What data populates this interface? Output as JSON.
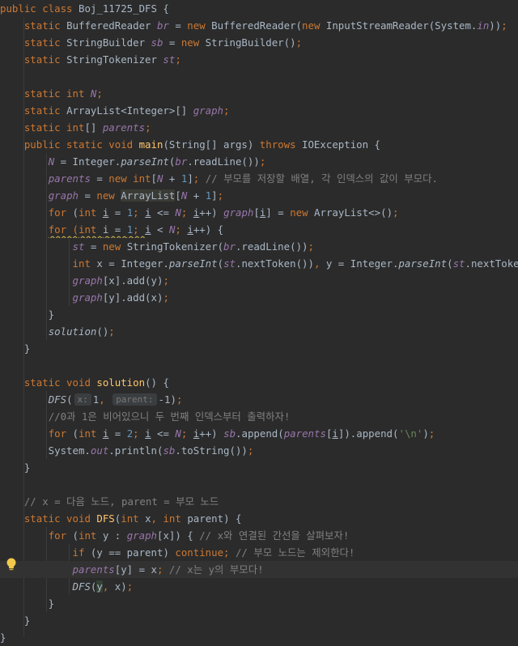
{
  "lines": [
    [
      [
        "public class ",
        "kw"
      ],
      [
        "Boj_11725_DFS ",
        ""
      ],
      [
        "{",
        ""
      ]
    ],
    [
      [
        "    ",
        ""
      ],
      [
        "static ",
        "kw"
      ],
      [
        "BufferedReader ",
        ""
      ],
      [
        "br",
        "sfield"
      ],
      [
        " = ",
        ""
      ],
      [
        "new ",
        "kw"
      ],
      [
        "BufferedReader(",
        ""
      ],
      [
        "new ",
        "kw"
      ],
      [
        "InputStreamReader(System.",
        ""
      ],
      [
        "in",
        "sfield"
      ],
      [
        "))",
        ""
      ],
      [
        ";",
        "kw"
      ]
    ],
    [
      [
        "    ",
        ""
      ],
      [
        "static ",
        "kw"
      ],
      [
        "StringBuilder ",
        ""
      ],
      [
        "sb",
        "sfield"
      ],
      [
        " = ",
        ""
      ],
      [
        "new ",
        "kw"
      ],
      [
        "StringBuilder()",
        ""
      ],
      [
        ";",
        "kw"
      ]
    ],
    [
      [
        "    ",
        ""
      ],
      [
        "static ",
        "kw"
      ],
      [
        "StringTokenizer ",
        ""
      ],
      [
        "st",
        "sfield"
      ],
      [
        ";",
        "kw"
      ]
    ],
    [],
    [
      [
        "    ",
        ""
      ],
      [
        "static int ",
        "kw"
      ],
      [
        "N",
        "sfield"
      ],
      [
        ";",
        "kw"
      ]
    ],
    [
      [
        "    ",
        ""
      ],
      [
        "static ",
        "kw"
      ],
      [
        "ArrayList<Integer>[] ",
        ""
      ],
      [
        "graph",
        "sfield"
      ],
      [
        ";",
        "kw"
      ]
    ],
    [
      [
        "    ",
        ""
      ],
      [
        "static int",
        "kw"
      ],
      [
        "[] ",
        ""
      ],
      [
        "parents",
        "sfield"
      ],
      [
        ";",
        "kw"
      ]
    ],
    [
      [
        "    ",
        ""
      ],
      [
        "public static void ",
        "kw"
      ],
      [
        "main",
        "fn"
      ],
      [
        "(String[] args) ",
        ""
      ],
      [
        "throws ",
        "kw"
      ],
      [
        "IOException {",
        ""
      ]
    ],
    [
      [
        "        ",
        ""
      ],
      [
        "N",
        "sfield"
      ],
      [
        " = Integer.",
        ""
      ],
      [
        "parseInt",
        "smeth"
      ],
      [
        "(",
        ""
      ],
      [
        "br",
        "sfield"
      ],
      [
        ".readLine())",
        ""
      ],
      [
        ";",
        "kw"
      ]
    ],
    [
      [
        "        ",
        ""
      ],
      [
        "parents",
        "sfield"
      ],
      [
        " = ",
        ""
      ],
      [
        "new int",
        "kw"
      ],
      [
        "[",
        ""
      ],
      [
        "N",
        "sfield"
      ],
      [
        " + ",
        ""
      ],
      [
        "1",
        "num"
      ],
      [
        "]",
        ""
      ],
      [
        "; ",
        "kw"
      ],
      [
        "// 부모를 저장할 배열, 각 인덱스의 값이 부모다.",
        "cmt"
      ]
    ],
    [
      [
        "        ",
        ""
      ],
      [
        "graph",
        "sfield"
      ],
      [
        " = ",
        ""
      ],
      [
        "new ",
        "kw"
      ],
      [
        "ArrayList",
        "hl"
      ],
      [
        "[",
        ""
      ],
      [
        "N",
        "sfield"
      ],
      [
        " + ",
        ""
      ],
      [
        "1",
        "num"
      ],
      [
        "]",
        ""
      ],
      [
        ";",
        "kw"
      ]
    ],
    [
      [
        "        ",
        ""
      ],
      [
        "for ",
        "kw"
      ],
      [
        "(",
        ""
      ],
      [
        "int ",
        "kw"
      ],
      [
        "i",
        "lvar"
      ],
      [
        " = ",
        ""
      ],
      [
        "1",
        "num"
      ],
      [
        "; ",
        "kw"
      ],
      [
        "i",
        "lvar"
      ],
      [
        " <= ",
        ""
      ],
      [
        "N",
        "sfield"
      ],
      [
        "; ",
        "kw"
      ],
      [
        "i",
        "lvar"
      ],
      [
        "++) ",
        ""
      ],
      [
        "graph",
        "sfield"
      ],
      [
        "[",
        ""
      ],
      [
        "i",
        "lvar"
      ],
      [
        "] = ",
        ""
      ],
      [
        "new ",
        "kw"
      ],
      [
        "ArrayList<>()",
        ""
      ],
      [
        ";",
        "kw"
      ]
    ],
    [
      [
        "        ",
        ""
      ],
      [
        "for (",
        "warn kw"
      ],
      [
        "int ",
        "warn kw"
      ],
      [
        "i",
        "warn lvar"
      ],
      [
        " = ",
        "warn"
      ],
      [
        "1",
        "warn num"
      ],
      [
        "; ",
        "warn kw"
      ],
      [
        "i",
        "lvar"
      ],
      [
        " < ",
        ""
      ],
      [
        "N",
        "sfield"
      ],
      [
        "; ",
        "kw"
      ],
      [
        "i",
        "lvar"
      ],
      [
        "++) {",
        ""
      ]
    ],
    [
      [
        "            ",
        ""
      ],
      [
        "st",
        "sfield"
      ],
      [
        " = ",
        ""
      ],
      [
        "new ",
        "kw"
      ],
      [
        "StringTokenizer(",
        ""
      ],
      [
        "br",
        "sfield"
      ],
      [
        ".readLine())",
        ""
      ],
      [
        ";",
        "kw"
      ]
    ],
    [
      [
        "            ",
        ""
      ],
      [
        "int ",
        "kw"
      ],
      [
        "x = Integer.",
        ""
      ],
      [
        "parseInt",
        "smeth"
      ],
      [
        "(",
        ""
      ],
      [
        "st",
        "sfield"
      ],
      [
        ".nextToken())",
        ""
      ],
      [
        ", ",
        "kw"
      ],
      [
        "y = Integer.",
        ""
      ],
      [
        "parseInt",
        "smeth"
      ],
      [
        "(",
        ""
      ],
      [
        "st",
        "sfield"
      ],
      [
        ".nextToken())",
        ""
      ],
      [
        ";",
        "kw"
      ]
    ],
    [
      [
        "            ",
        ""
      ],
      [
        "graph",
        "sfield"
      ],
      [
        "[x].add(y)",
        ""
      ],
      [
        ";",
        "kw"
      ]
    ],
    [
      [
        "            ",
        ""
      ],
      [
        "graph",
        "sfield"
      ],
      [
        "[y].add(x)",
        ""
      ],
      [
        ";",
        "kw"
      ]
    ],
    [
      [
        "        }",
        ""
      ]
    ],
    [
      [
        "        ",
        ""
      ],
      [
        "solution",
        "smeth"
      ],
      [
        "()",
        ""
      ],
      [
        ";",
        "kw"
      ]
    ],
    [
      [
        "    }",
        ""
      ]
    ],
    [],
    [
      [
        "    ",
        ""
      ],
      [
        "static void ",
        "kw"
      ],
      [
        "solution",
        "fn"
      ],
      [
        "() {",
        ""
      ]
    ],
    [
      [
        "        ",
        ""
      ],
      [
        "DFS",
        "smeth"
      ],
      [
        "(",
        ""
      ],
      [
        "x:",
        "hint"
      ],
      [
        "1",
        ""
      ],
      [
        ", ",
        "kw"
      ],
      [
        "parent:",
        "hint"
      ],
      [
        "-1)",
        ""
      ],
      [
        ";",
        "kw"
      ]
    ],
    [
      [
        "        ",
        ""
      ],
      [
        "//0과 1은 비어있으니 두 번째 인덱스부터 출력하자!",
        "cmt"
      ]
    ],
    [
      [
        "        ",
        ""
      ],
      [
        "for ",
        "kw"
      ],
      [
        "(",
        ""
      ],
      [
        "int ",
        "kw"
      ],
      [
        "i",
        "lvar"
      ],
      [
        " = ",
        ""
      ],
      [
        "2",
        "num"
      ],
      [
        "; ",
        "kw"
      ],
      [
        "i",
        "lvar"
      ],
      [
        " <= ",
        ""
      ],
      [
        "N",
        "sfield"
      ],
      [
        "; ",
        "kw"
      ],
      [
        "i",
        "lvar"
      ],
      [
        "++) ",
        ""
      ],
      [
        "sb",
        "sfield"
      ],
      [
        ".append(",
        ""
      ],
      [
        "parents",
        "sfield"
      ],
      [
        "[",
        ""
      ],
      [
        "i",
        "lvar"
      ],
      [
        "]).append(",
        ""
      ],
      [
        "'\\n'",
        "str"
      ],
      [
        ")",
        ""
      ],
      [
        ";",
        "kw"
      ]
    ],
    [
      [
        "        System.",
        ""
      ],
      [
        "out",
        "sfield"
      ],
      [
        ".println(",
        ""
      ],
      [
        "sb",
        "sfield"
      ],
      [
        ".toString())",
        ""
      ],
      [
        ";",
        "kw"
      ]
    ],
    [
      [
        "    }",
        ""
      ]
    ],
    [],
    [
      [
        "    ",
        ""
      ],
      [
        "// x = 다음 노드, parent = 부모 노드",
        "cmt"
      ]
    ],
    [
      [
        "    ",
        ""
      ],
      [
        "static void ",
        "kw"
      ],
      [
        "DFS",
        "fn"
      ],
      [
        "(",
        ""
      ],
      [
        "int ",
        "kw"
      ],
      [
        "x",
        ""
      ],
      [
        ", ",
        "kw"
      ],
      [
        "int ",
        "kw"
      ],
      [
        "parent) {",
        ""
      ]
    ],
    [
      [
        "        ",
        ""
      ],
      [
        "for ",
        "kw"
      ],
      [
        "(",
        ""
      ],
      [
        "int ",
        "kw"
      ],
      [
        "y : ",
        ""
      ],
      [
        "graph",
        "sfield"
      ],
      [
        "[x]) { ",
        ""
      ],
      [
        "// x와 연결된 간선을 살펴보자!",
        "cmt"
      ]
    ],
    [
      [
        "            ",
        ""
      ],
      [
        "if ",
        "kw"
      ],
      [
        "(y == parent) ",
        ""
      ],
      [
        "continue; ",
        "kw"
      ],
      [
        "// 부모 노드는 제외한다!",
        "cmt"
      ]
    ],
    [
      [
        "            ",
        ""
      ],
      [
        "parents",
        "sfield"
      ],
      [
        "[y] = x",
        ""
      ],
      [
        "; ",
        "kw"
      ],
      [
        "// x는 y의 부모다!",
        "cmt"
      ]
    ],
    [
      [
        "            ",
        ""
      ],
      [
        "DFS",
        "smeth"
      ],
      [
        "(",
        ""
      ],
      [
        "y",
        "hlvar"
      ],
      [
        ", ",
        "kw"
      ],
      [
        "x)",
        ""
      ],
      [
        ";",
        "kw"
      ]
    ],
    [
      [
        "        }",
        ""
      ]
    ],
    [
      [
        "    }",
        ""
      ]
    ],
    [
      [
        "}",
        ""
      ]
    ]
  ],
  "current_line_index": 33,
  "gutter_icon": "lightbulb-icon"
}
